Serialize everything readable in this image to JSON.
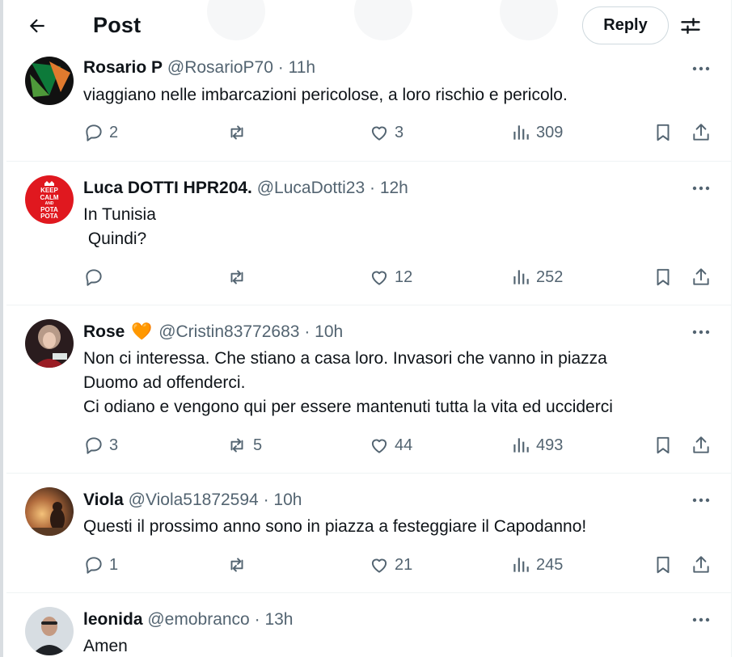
{
  "header": {
    "title": "Post",
    "reply_label": "Reply",
    "back_icon": "arrow-left-icon",
    "filter_icon": "sliders-icon"
  },
  "colors": {
    "text": "#0f1419",
    "secondary": "#536471",
    "divider": "#eff3f4",
    "heart_emoji": "#f7931e"
  },
  "tweets": [
    {
      "name": "Rosario P",
      "handle": "@RosarioP70",
      "time": "11h",
      "lines": [
        "viaggiano nelle  imbarcazioni pericolose, a loro rischio e pericolo."
      ],
      "replies": "2",
      "retweets": "",
      "likes": "3",
      "views": "309"
    },
    {
      "name": "Luca DOTTI HPR204.",
      "handle": "@LucaDotti23",
      "time": "12h",
      "avatar_text": [
        "KEEP",
        "CALM",
        "AND",
        "POTA",
        "POTA"
      ],
      "lines": [
        "In Tunisia",
        " Quindi?"
      ],
      "replies": "",
      "retweets": "",
      "likes": "12",
      "views": "252"
    },
    {
      "name": "Rose",
      "name_emoji": "🧡",
      "handle": "@Cristin83772683",
      "time": "10h",
      "lines": [
        "Non ci interessa. Che stiano a casa loro. Invasori che vanno in piazza",
        "Duomo ad offenderci.",
        "Ci odiano e vengono qui per essere  mantenuti tutta la vita ed ucciderci"
      ],
      "replies": "3",
      "retweets": "5",
      "likes": "44",
      "views": "493"
    },
    {
      "name": "Viola",
      "handle": "@Viola51872594",
      "time": "10h",
      "lines": [
        "Questi il prossimo anno sono in piazza a festeggiare il Capodanno!"
      ],
      "replies": "1",
      "retweets": "",
      "likes": "21",
      "views": "245"
    },
    {
      "name": "leonida",
      "handle": "@emobranco",
      "time": "13h",
      "lines": [
        "Amen"
      ]
    }
  ]
}
